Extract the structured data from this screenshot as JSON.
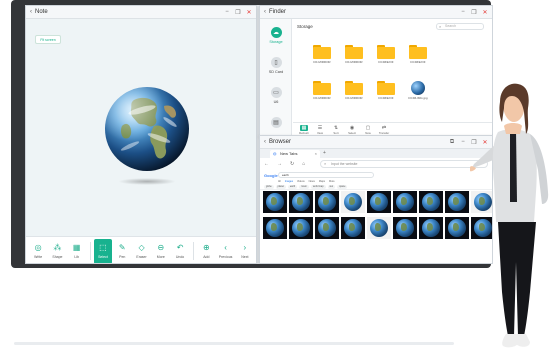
{
  "note": {
    "title": "Note",
    "chip_label": "Fit screen",
    "toolbar": [
      {
        "label": "Write",
        "icon": "pen-circle-icon"
      },
      {
        "label": "Shape",
        "icon": "shape-icon"
      },
      {
        "label": "Lib",
        "icon": "library-icon"
      },
      {
        "label": "Select",
        "icon": "select-icon",
        "active": true
      },
      {
        "label": "Pen",
        "icon": "pen-icon"
      },
      {
        "label": "Eraser",
        "icon": "eraser-icon"
      },
      {
        "label": "More",
        "icon": "more-icon"
      },
      {
        "label": "Undo",
        "icon": "undo-icon"
      },
      {
        "label": "Add",
        "icon": "add-icon"
      },
      {
        "label": "Previous",
        "icon": "previous-icon"
      },
      {
        "label": "Next",
        "icon": "next-icon"
      }
    ]
  },
  "finder": {
    "title": "Finder",
    "section_title": "Storage",
    "search_placeholder": "Search",
    "sidebar": [
      {
        "label": "Storage",
        "icon": "cloud-icon",
        "active": true
      },
      {
        "label": "SD Card",
        "icon": "sd-card-icon"
      },
      {
        "label": "U6",
        "icon": "usb-icon"
      },
      {
        "label": "",
        "icon": "drive-icon"
      }
    ],
    "folders": [
      "DF-MIRROR",
      "DF-MIRROR",
      "DCIM/EXIF",
      "DCIM/EXIF",
      "DF-MIRROR",
      "DF-MIRROR",
      "DCIM/EXIF",
      "DCIM-IMG.jpg"
    ],
    "toolbar": [
      {
        "label": "Refresh",
        "icon": "grid-icon",
        "active": true
      },
      {
        "label": "View",
        "icon": "list-icon"
      },
      {
        "label": "Sort",
        "icon": "sort-icon"
      },
      {
        "label": "Select",
        "icon": "select-icon"
      },
      {
        "label": "New",
        "icon": "folder-add-icon"
      },
      {
        "label": "Transfer",
        "icon": "transfer-icon"
      }
    ]
  },
  "browser": {
    "title": "Browser",
    "tab_label": "New Tabs",
    "url_placeholder": "Input the website",
    "search_logo": "Google",
    "search_query": "earth",
    "result_tabs": [
      "All",
      "Images",
      "Videos",
      "News",
      "Maps",
      "More"
    ],
    "chips": [
      "globe",
      "planet",
      "earth",
      "moon",
      "world map",
      "sun",
      "space"
    ],
    "thumb_count": 18
  },
  "colors": {
    "accent": "#19b28f",
    "folder": "#ffbf1f",
    "close": "#e53935"
  }
}
